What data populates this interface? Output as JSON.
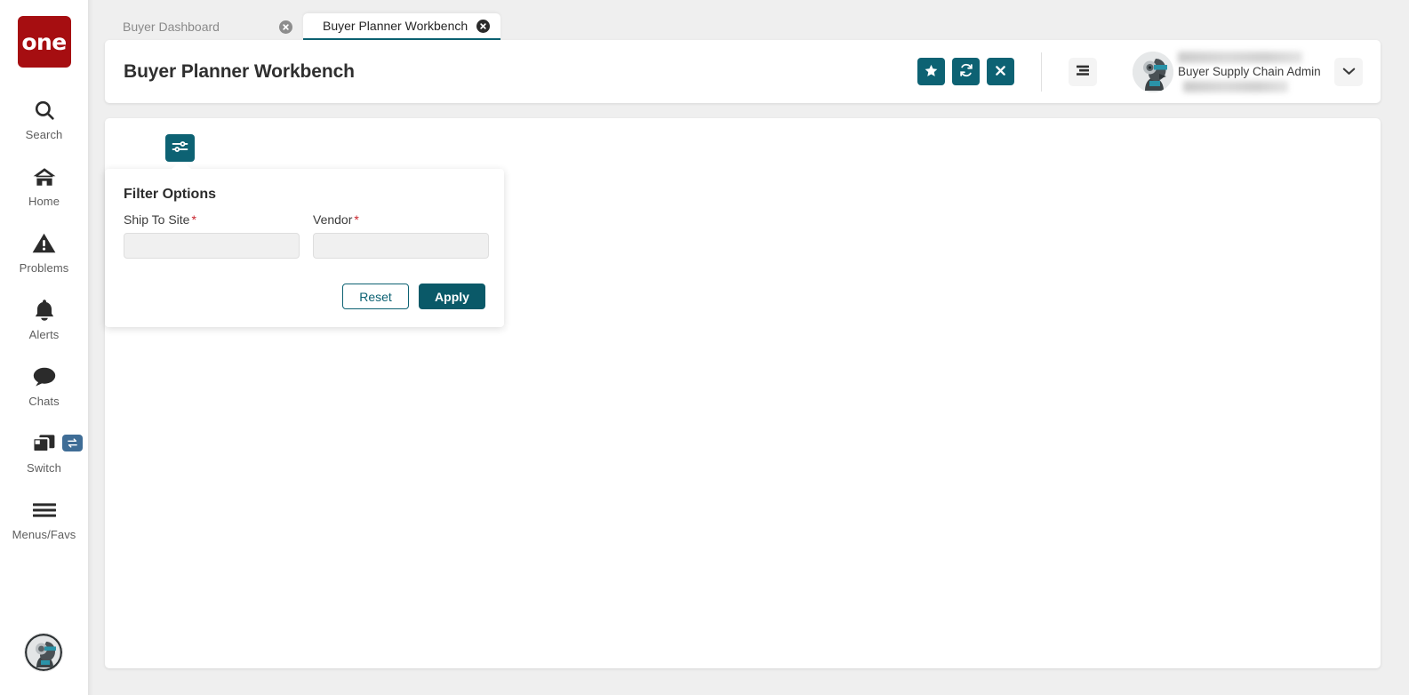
{
  "brand": {
    "logo_text": "one",
    "logo_color": "#a60e11"
  },
  "theme": {
    "accent": "#0d6273",
    "accent_dark": "#0a5968",
    "required_star": "#c8232c",
    "page_bg": "#efefef"
  },
  "sidebar": {
    "items": [
      {
        "icon": "search-icon",
        "label": "Search"
      },
      {
        "icon": "home-icon",
        "label": "Home"
      },
      {
        "icon": "problems-warning-icon",
        "label": "Problems"
      },
      {
        "icon": "alerts-bell-icon",
        "label": "Alerts"
      },
      {
        "icon": "chats-bubble-icon",
        "label": "Chats"
      },
      {
        "icon": "switch-windows-icon",
        "label": "Switch"
      },
      {
        "icon": "menus-favs-hamburger-icon",
        "label": "Menus/Favs"
      }
    ],
    "switch_badge_icon": "swap-arrows-icon",
    "bottom_avatar_icon": "user-avatar-icon"
  },
  "tabs": [
    {
      "label": "Buyer Dashboard",
      "active": false,
      "close_icon": "close-circle-icon"
    },
    {
      "label": "Buyer Planner Workbench",
      "active": true,
      "close_icon": "close-circle-icon"
    }
  ],
  "header": {
    "title": "Buyer Planner Workbench",
    "actions": [
      {
        "name": "favorite-button",
        "icon": "star-icon"
      },
      {
        "name": "refresh-button",
        "icon": "refresh-icon"
      },
      {
        "name": "close-button",
        "icon": "x-icon"
      }
    ],
    "menu_button_icon": "hamburger-menu-icon",
    "user": {
      "name_redacted": true,
      "role": "Buyer Supply Chain Admin",
      "org_redacted": true,
      "avatar_icon": "user-avatar-icon",
      "caret_icon": "chevron-down-icon"
    }
  },
  "content": {
    "filter_toggle_icon": "filter-sliders-icon",
    "filter_panel": {
      "title": "Filter Options",
      "fields": [
        {
          "label": "Ship To Site",
          "required": true,
          "value": "",
          "placeholder": ""
        },
        {
          "label": "Vendor",
          "required": true,
          "value": "",
          "placeholder": ""
        }
      ],
      "reset_label": "Reset",
      "apply_label": "Apply"
    }
  }
}
